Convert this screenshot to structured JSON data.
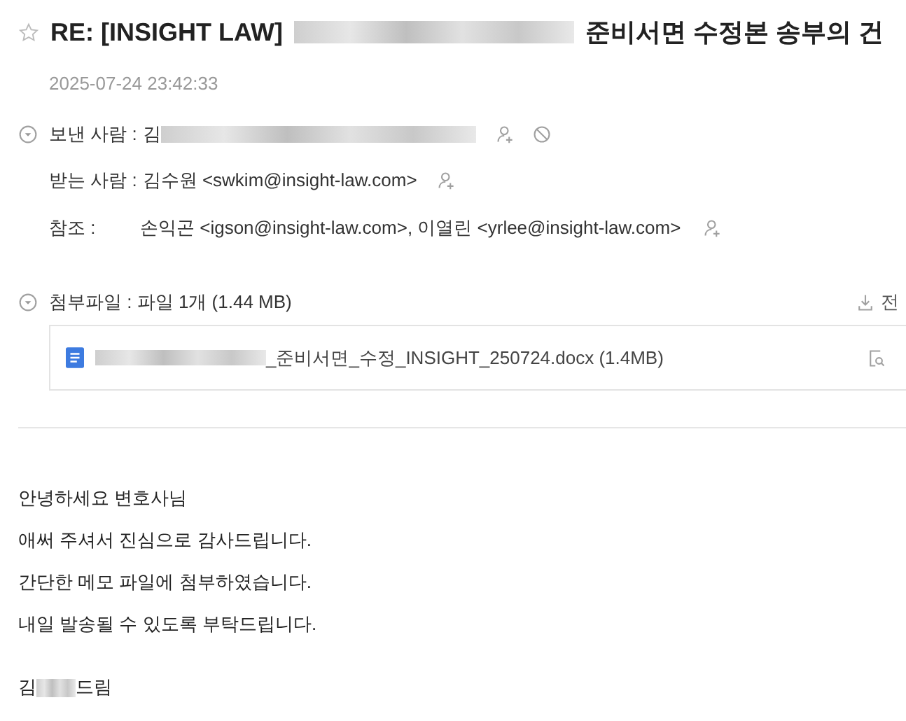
{
  "subject": {
    "starred": false,
    "prefix": "RE: [INSIGHT LAW]",
    "suffix": "준비서면 수정본 송부의 건"
  },
  "date": "2025-07-24 23:42:33",
  "sender": {
    "label": "보낸 사람 :",
    "name": "김",
    "expanded": false
  },
  "to": {
    "label": "받는 사람 :",
    "value": "김수원 <swkim@insight-law.com>"
  },
  "cc": {
    "label": "참조 :",
    "value": "손익곤 <igson@insight-law.com>, 이열린 <yrlee@insight-law.com>"
  },
  "attachments": {
    "label": "첨부파일 : 파일 1개 (1.44 MB)",
    "download_all": "전",
    "expanded": false,
    "files": [
      {
        "name": "_준비서면_수정_INSIGHT_250724.docx (1.4MB)"
      }
    ]
  },
  "body": [
    "안녕하세요 변호사님",
    "애써 주셔서 진심으로 감사드립니다.",
    "간단한 메모 파일에 첨부하였습니다.",
    "내일 발송될 수 있도록 부탁드립니다."
  ],
  "signature": {
    "before": "김",
    "after": "드림"
  }
}
